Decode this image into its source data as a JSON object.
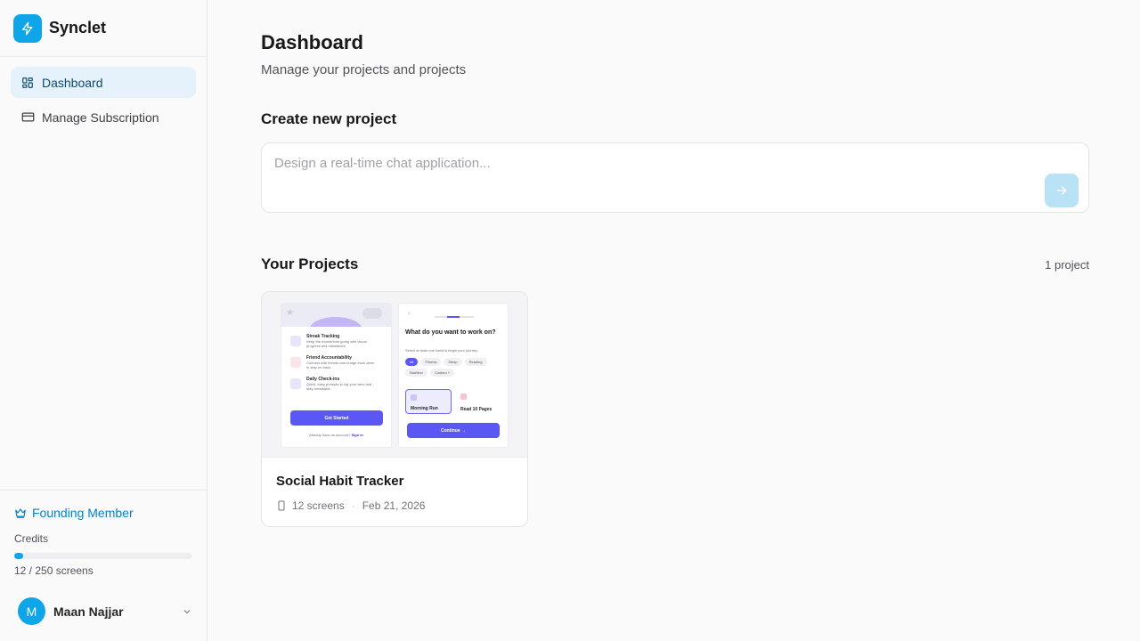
{
  "app": {
    "name": "Synclet"
  },
  "sidebar": {
    "items": [
      {
        "label": "Dashboard",
        "icon": "dashboard-grid-icon",
        "active": true
      },
      {
        "label": "Manage Subscription",
        "icon": "credit-card-icon",
        "active": false
      }
    ],
    "membership": {
      "label": "Founding Member",
      "icon": "crown-icon"
    },
    "credits": {
      "label": "Credits",
      "text": "12 / 250 screens",
      "used": 12,
      "total": 250
    },
    "user": {
      "initial": "M",
      "name": "Maan Najjar"
    }
  },
  "main": {
    "title": "Dashboard",
    "subtitle": "Manage your projects and projects",
    "create": {
      "heading": "Create new project",
      "placeholder": "Design a real-time chat application...",
      "value": ""
    },
    "projects": {
      "heading": "Your Projects",
      "count_label": "1 project",
      "items": [
        {
          "title": "Social Habit Tracker",
          "screens": "12 screens",
          "date": "Feb 21, 2026",
          "preview": {
            "onboarding": {
              "features": [
                {
                  "title": "Streak Tracking",
                  "desc": "Keep the momentum going with visual progress and milestones."
                },
                {
                  "title": "Friend Accountability",
                  "desc": "Connect with friends and nudge each other to stay on track."
                },
                {
                  "title": "Daily Check-ins",
                  "desc": "Quick, easy prompts to log your wins and stay consistent."
                }
              ],
              "cta": "Get Started",
              "footer_text": "Already have an account?",
              "footer_link": "Sign in"
            },
            "picker": {
              "question": "What do you want to work on?",
              "hint": "Select at least one habit to begin your journey.",
              "chips": [
                "All",
                "Fitness",
                "Sleep",
                "Reading",
                "Nutrition",
                "Custom +"
              ],
              "tiles": [
                "Morning Run",
                "Read 10 Pages"
              ],
              "cta": "Continue →"
            }
          }
        }
      ]
    }
  },
  "colors": {
    "accent": "#0ea5e9",
    "preview_primary": "#5b57f5"
  }
}
